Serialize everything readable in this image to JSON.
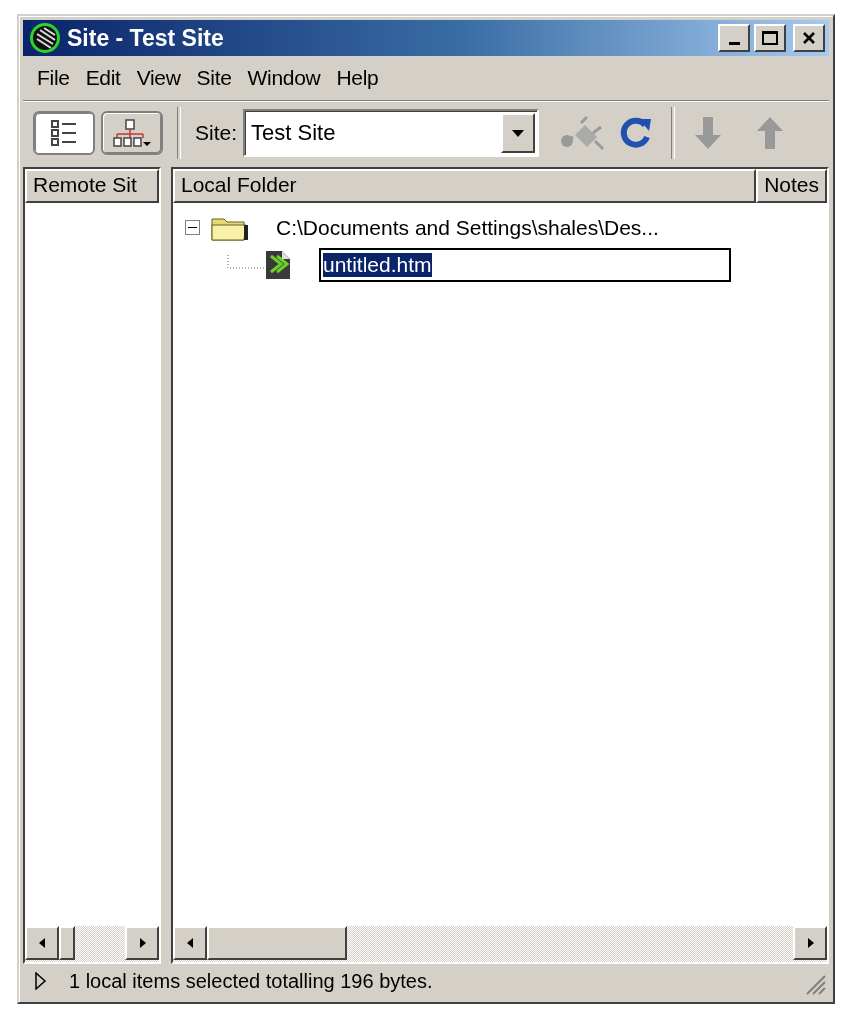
{
  "window": {
    "title": "Site - Test Site"
  },
  "menu": [
    {
      "label": "File"
    },
    {
      "label": "Edit"
    },
    {
      "label": "View"
    },
    {
      "label": "Site"
    },
    {
      "label": "Window"
    },
    {
      "label": "Help"
    }
  ],
  "toolbar": {
    "view_buttons": [
      {
        "kind": "files",
        "selected": true
      },
      {
        "kind": "map",
        "selected": false
      }
    ],
    "site_label": "Site:",
    "site_value": "Test Site"
  },
  "remote_pane": {
    "columns": [
      "Remote Sit"
    ]
  },
  "local_pane": {
    "columns": [
      "Local Folder",
      "Notes"
    ],
    "tree": [
      {
        "label": "C:\\Documents and Settings\\shales\\Des...",
        "expanded": true,
        "children": [
          {
            "label": "untitled.htm",
            "editing": true
          }
        ]
      }
    ]
  },
  "status_bar": {
    "text": "1 local items selected totalling 196 bytes."
  }
}
